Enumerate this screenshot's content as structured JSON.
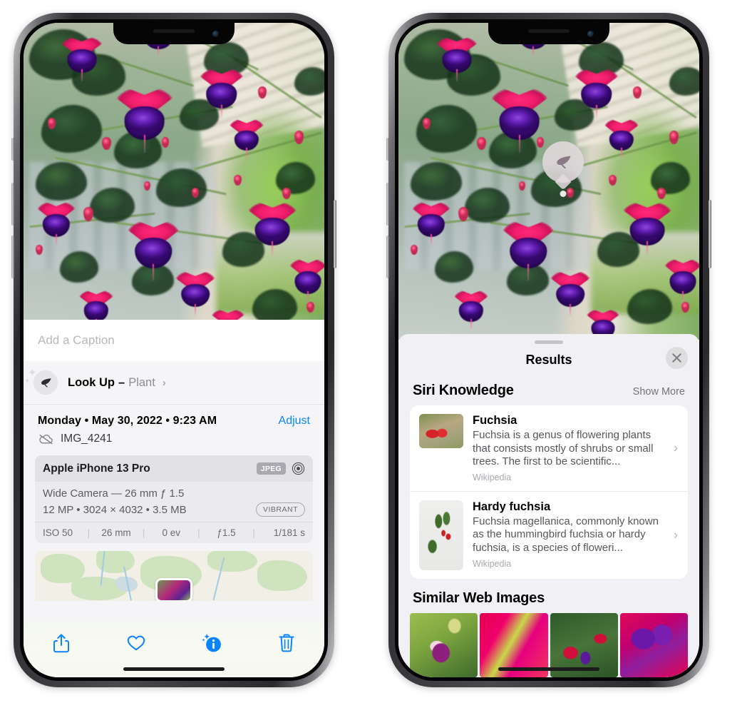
{
  "left_phone": {
    "name": "iphone-photos-info-view",
    "caption_placeholder": "Add a Caption",
    "caption_value": "",
    "lookup": {
      "label": "Look Up",
      "dash": "–",
      "value": "Plant",
      "chevron": "›",
      "icon": "leaf-icon"
    },
    "meta": {
      "date": "Monday • May 30, 2022 • 9:23 AM",
      "adjust_label": "Adjust",
      "filename": "IMG_4241",
      "cloud_icon": "cloud-slash-icon"
    },
    "camera_card": {
      "device": "Apple iPhone 13 Pro",
      "format_chip": "JPEG",
      "lens_icon": "aperture-icon",
      "lens_line": "Wide Camera — 26 mm ƒ 1.5",
      "specs_line": "12 MP • 3024 × 4032 • 3.5 MB",
      "style_chip": "VIBRANT",
      "exif": [
        {
          "label": "ISO 50"
        },
        {
          "label": "26 mm"
        },
        {
          "label": "0 ev"
        },
        {
          "label": "ƒ1.5"
        },
        {
          "label": "1/181 s"
        }
      ]
    },
    "toolbar": [
      {
        "name": "share-button",
        "icon": "share-icon"
      },
      {
        "name": "favorite-button",
        "icon": "heart-icon"
      },
      {
        "name": "info-button",
        "icon": "info-sparkle-icon"
      },
      {
        "name": "delete-button",
        "icon": "trash-icon"
      }
    ]
  },
  "right_phone": {
    "name": "iphone-visual-lookup-results",
    "badge": {
      "name": "visual-lookup-badge",
      "icon": "leaf-icon"
    },
    "sheet": {
      "title": "Results",
      "close_icon": "close-icon",
      "sections": [
        {
          "title": "Siri Knowledge",
          "action": "Show More",
          "items": [
            {
              "title": "Fuchsia",
              "description": "Fuchsia is a genus of flowering plants that consists mostly of shrubs or small trees. The first to be scientific...",
              "source": "Wikipedia",
              "chevron": "›"
            },
            {
              "title": "Hardy fuchsia",
              "description": "Fuchsia magellanica, commonly known as the hummingbird fuchsia or hardy fuchsia, is a species of floweri...",
              "source": "Wikipedia",
              "chevron": "›"
            }
          ]
        },
        {
          "title": "Similar Web Images",
          "action": "",
          "thumbnails": [
            {
              "name": "web-image-1"
            },
            {
              "name": "web-image-2"
            },
            {
              "name": "web-image-3"
            },
            {
              "name": "web-image-4"
            }
          ]
        }
      ]
    }
  },
  "colors": {
    "accent_blue": "#0a84ff",
    "sheet_bg": "#f1f1f5",
    "card_bg": "#ffffff",
    "secondary_text": "#8e8e93"
  }
}
